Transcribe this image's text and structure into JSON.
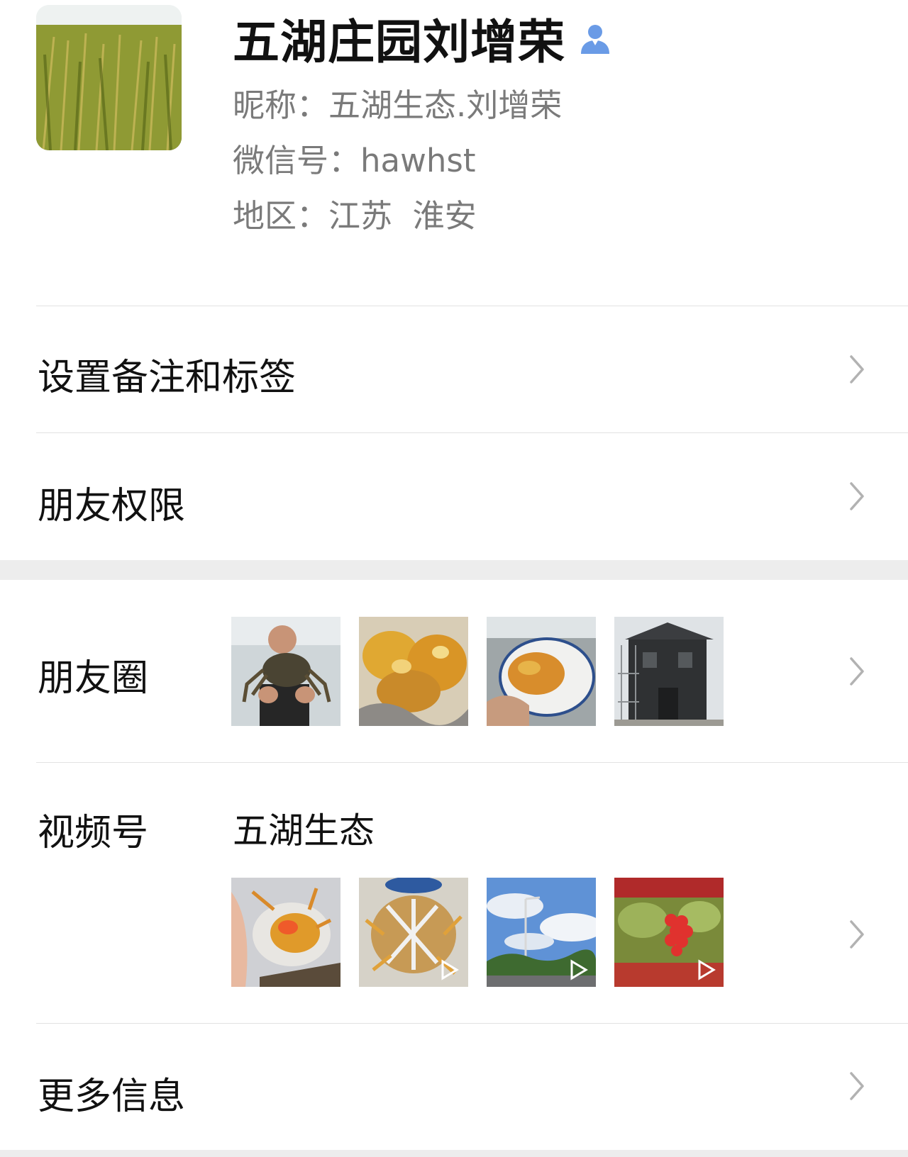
{
  "profile": {
    "display_name": "五湖庄园刘增荣",
    "nickname_line": "昵称：五湖生态.刘增荣",
    "wechat_id_line": "微信号：hawhst",
    "region_line": "地区：江苏  淮安",
    "badge_icon": "person-icon"
  },
  "menu": {
    "remark_tags": "设置备注和标签",
    "friend_permissions": "朋友权限",
    "moments": "朋友圈",
    "channels": "视频号",
    "more_info": "更多信息"
  },
  "channels": {
    "channel_name": "五湖生态"
  },
  "colors": {
    "badge_blue": "#6a9be6",
    "separator_gray": "#ededed",
    "chevron_gray": "#b2b2b2"
  },
  "icons": {
    "chevron": "chevron-right-icon",
    "play": "play-icon"
  }
}
